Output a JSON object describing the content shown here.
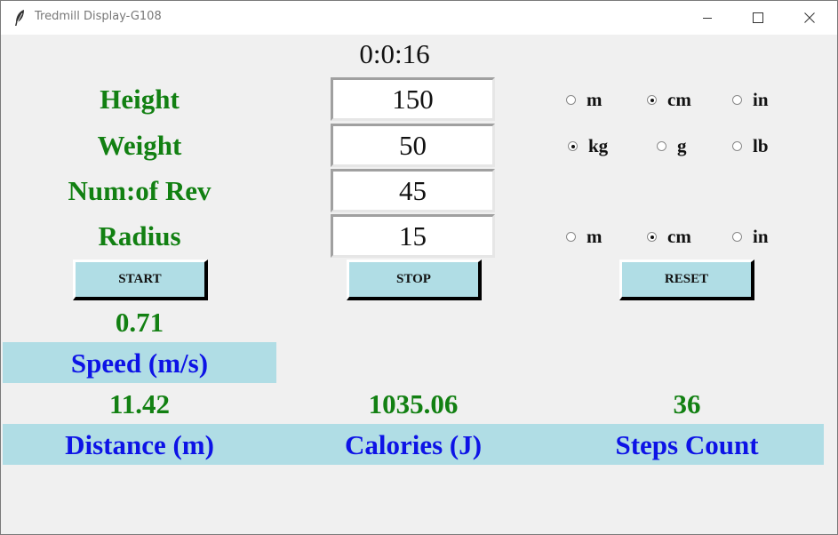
{
  "window": {
    "title": "Tredmill Display-G108"
  },
  "timer": "0:0:16",
  "fields": {
    "height": {
      "label": "Height",
      "value": "150"
    },
    "weight": {
      "label": "Weight",
      "value": "50"
    },
    "revs": {
      "label": "Num:of Rev",
      "value": "45"
    },
    "radius": {
      "label": "Radius",
      "value": "15"
    }
  },
  "units": {
    "height": [
      {
        "label": "m",
        "selected": false
      },
      {
        "label": "cm",
        "selected": true
      },
      {
        "label": "in",
        "selected": false
      }
    ],
    "weight": [
      {
        "label": "kg",
        "selected": true
      },
      {
        "label": "g",
        "selected": false
      },
      {
        "label": "lb",
        "selected": false
      }
    ],
    "radius": [
      {
        "label": "m",
        "selected": false
      },
      {
        "label": "cm",
        "selected": true
      },
      {
        "label": "in",
        "selected": false
      }
    ]
  },
  "buttons": {
    "start": "START",
    "stop": "STOP",
    "reset": "RESET"
  },
  "results": {
    "speed": {
      "value": "0.71",
      "label": "Speed (m/s)"
    },
    "distance": {
      "value": "11.42",
      "label": "Distance (m)"
    },
    "calories": {
      "value": "1035.06",
      "label": "Calories (J)"
    },
    "steps": {
      "value": "36",
      "label": "Steps Count"
    }
  },
  "colors": {
    "label_green": "#128012",
    "label_blue": "#0d13e6",
    "band_bg": "#b0dde5",
    "window_bg": "#f0f0f0"
  }
}
